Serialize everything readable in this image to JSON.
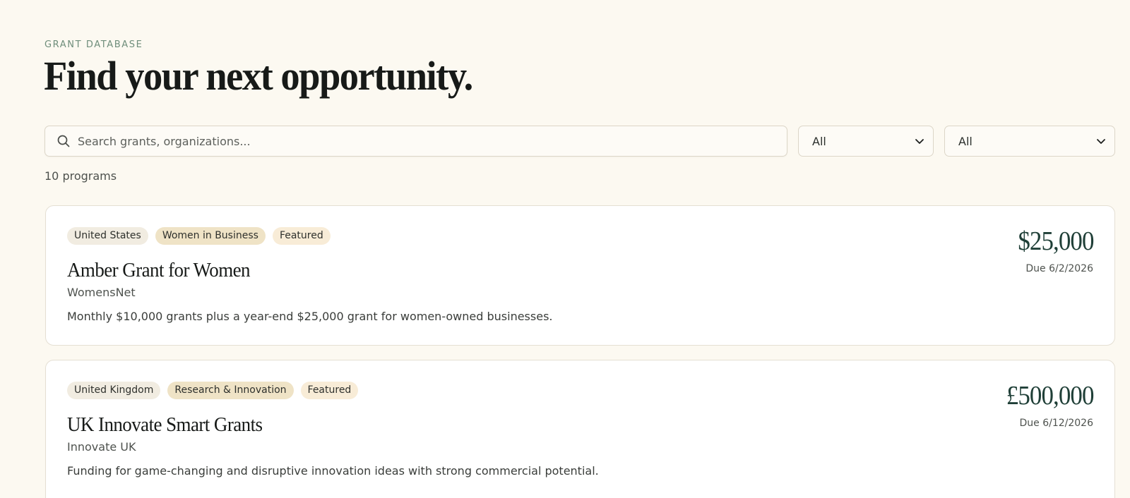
{
  "header": {
    "eyebrow": "GRANT DATABASE",
    "title": "Find your next opportunity."
  },
  "search": {
    "placeholder": "Search grants, organizations...",
    "value": ""
  },
  "filters": {
    "country": {
      "selected": "All"
    },
    "category": {
      "selected": "All"
    }
  },
  "results": {
    "count_label": "10 programs"
  },
  "grants": [
    {
      "tags": [
        "United States",
        "Women in Business",
        "Featured"
      ],
      "title": "Amber Grant for Women",
      "organization": "WomensNet",
      "description": "Monthly $10,000 grants plus a year-end $25,000 grant for women-owned businesses.",
      "amount": "$25,000",
      "due": "Due 6/2/2026"
    },
    {
      "tags": [
        "United Kingdom",
        "Research & Innovation",
        "Featured"
      ],
      "title": "UK Innovate Smart Grants",
      "organization": "Innovate UK",
      "description": "Funding for game-changing and disruptive innovation ideas with strong commercial potential.",
      "amount": "£500,000",
      "due": "Due 6/12/2026"
    }
  ],
  "icons": {
    "search": "search-icon",
    "dropdown": "chevron-down-icon"
  }
}
